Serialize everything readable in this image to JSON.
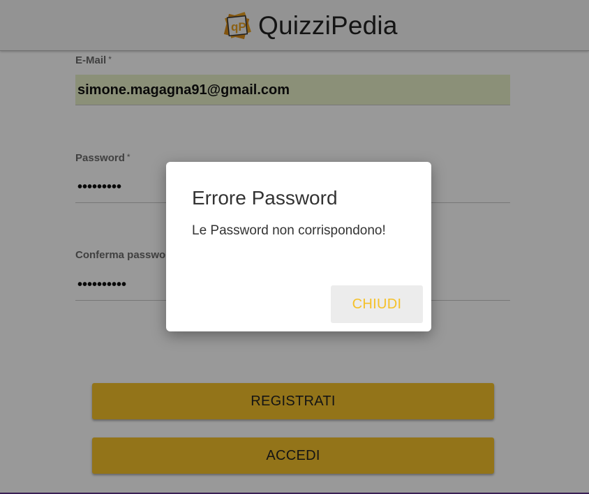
{
  "app": {
    "name": "QuizziPedia",
    "logo_glyph": "qP"
  },
  "form": {
    "email": {
      "label": "E-Mail",
      "required_mark": "*",
      "value": "simone.magagna91@gmail.com"
    },
    "password": {
      "label": "Password",
      "required_mark": "*",
      "value": "•••••••••"
    },
    "confirm_password": {
      "label": "Conferma password",
      "value": "••••••••••"
    },
    "register_label": "REGISTRATI",
    "login_label": "ACCEDI"
  },
  "dialog": {
    "title": "Errore Password",
    "message": "Le Password non corrispondono!",
    "close_label": "CHIUDI"
  },
  "colors": {
    "accent": "#f5c12a",
    "autofill_bg": "#e8f0c8",
    "overlay": "rgba(0,0,0,0.4)"
  }
}
